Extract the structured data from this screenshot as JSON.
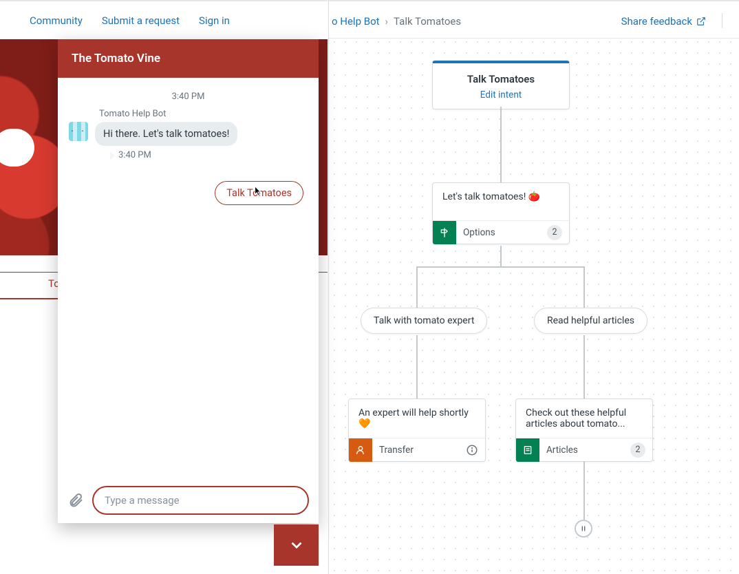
{
  "topnav": {
    "community": "Community",
    "submit": "Submit a request",
    "signin": "Sign in"
  },
  "hero": {
    "tab_label_fragment": "To"
  },
  "chat": {
    "title": "The Tomato Vine",
    "timestamp_top": "3:40 PM",
    "bot_name": "Tomato Help Bot",
    "bot_message": "Hi there. Let's talk tomatoes!",
    "timestamp_msg": "3:40 PM",
    "quick_reply": "Talk Tomatoes",
    "input_placeholder": "Type a message"
  },
  "builder": {
    "breadcrumb": {
      "prev_fragment": "o Help Bot",
      "current": "Talk Tomatoes"
    },
    "share": "Share feedback",
    "intent": {
      "title": "Talk Tomatoes",
      "edit": "Edit intent"
    },
    "options_step": {
      "text": "Let's talk tomatoes! 🍅",
      "footer": "Options",
      "badge": "2",
      "icon_color": "#038153"
    },
    "branch_left_pill": "Talk with tomato expert",
    "branch_right_pill": "Read helpful articles",
    "transfer_step": {
      "text": "An expert will help shortly 🧡",
      "footer": "Transfer",
      "icon_color": "#d65a0f"
    },
    "articles_step": {
      "text": "Check out these helpful articles about tomato...",
      "footer": "Articles",
      "badge": "2",
      "icon_color": "#038153"
    }
  }
}
